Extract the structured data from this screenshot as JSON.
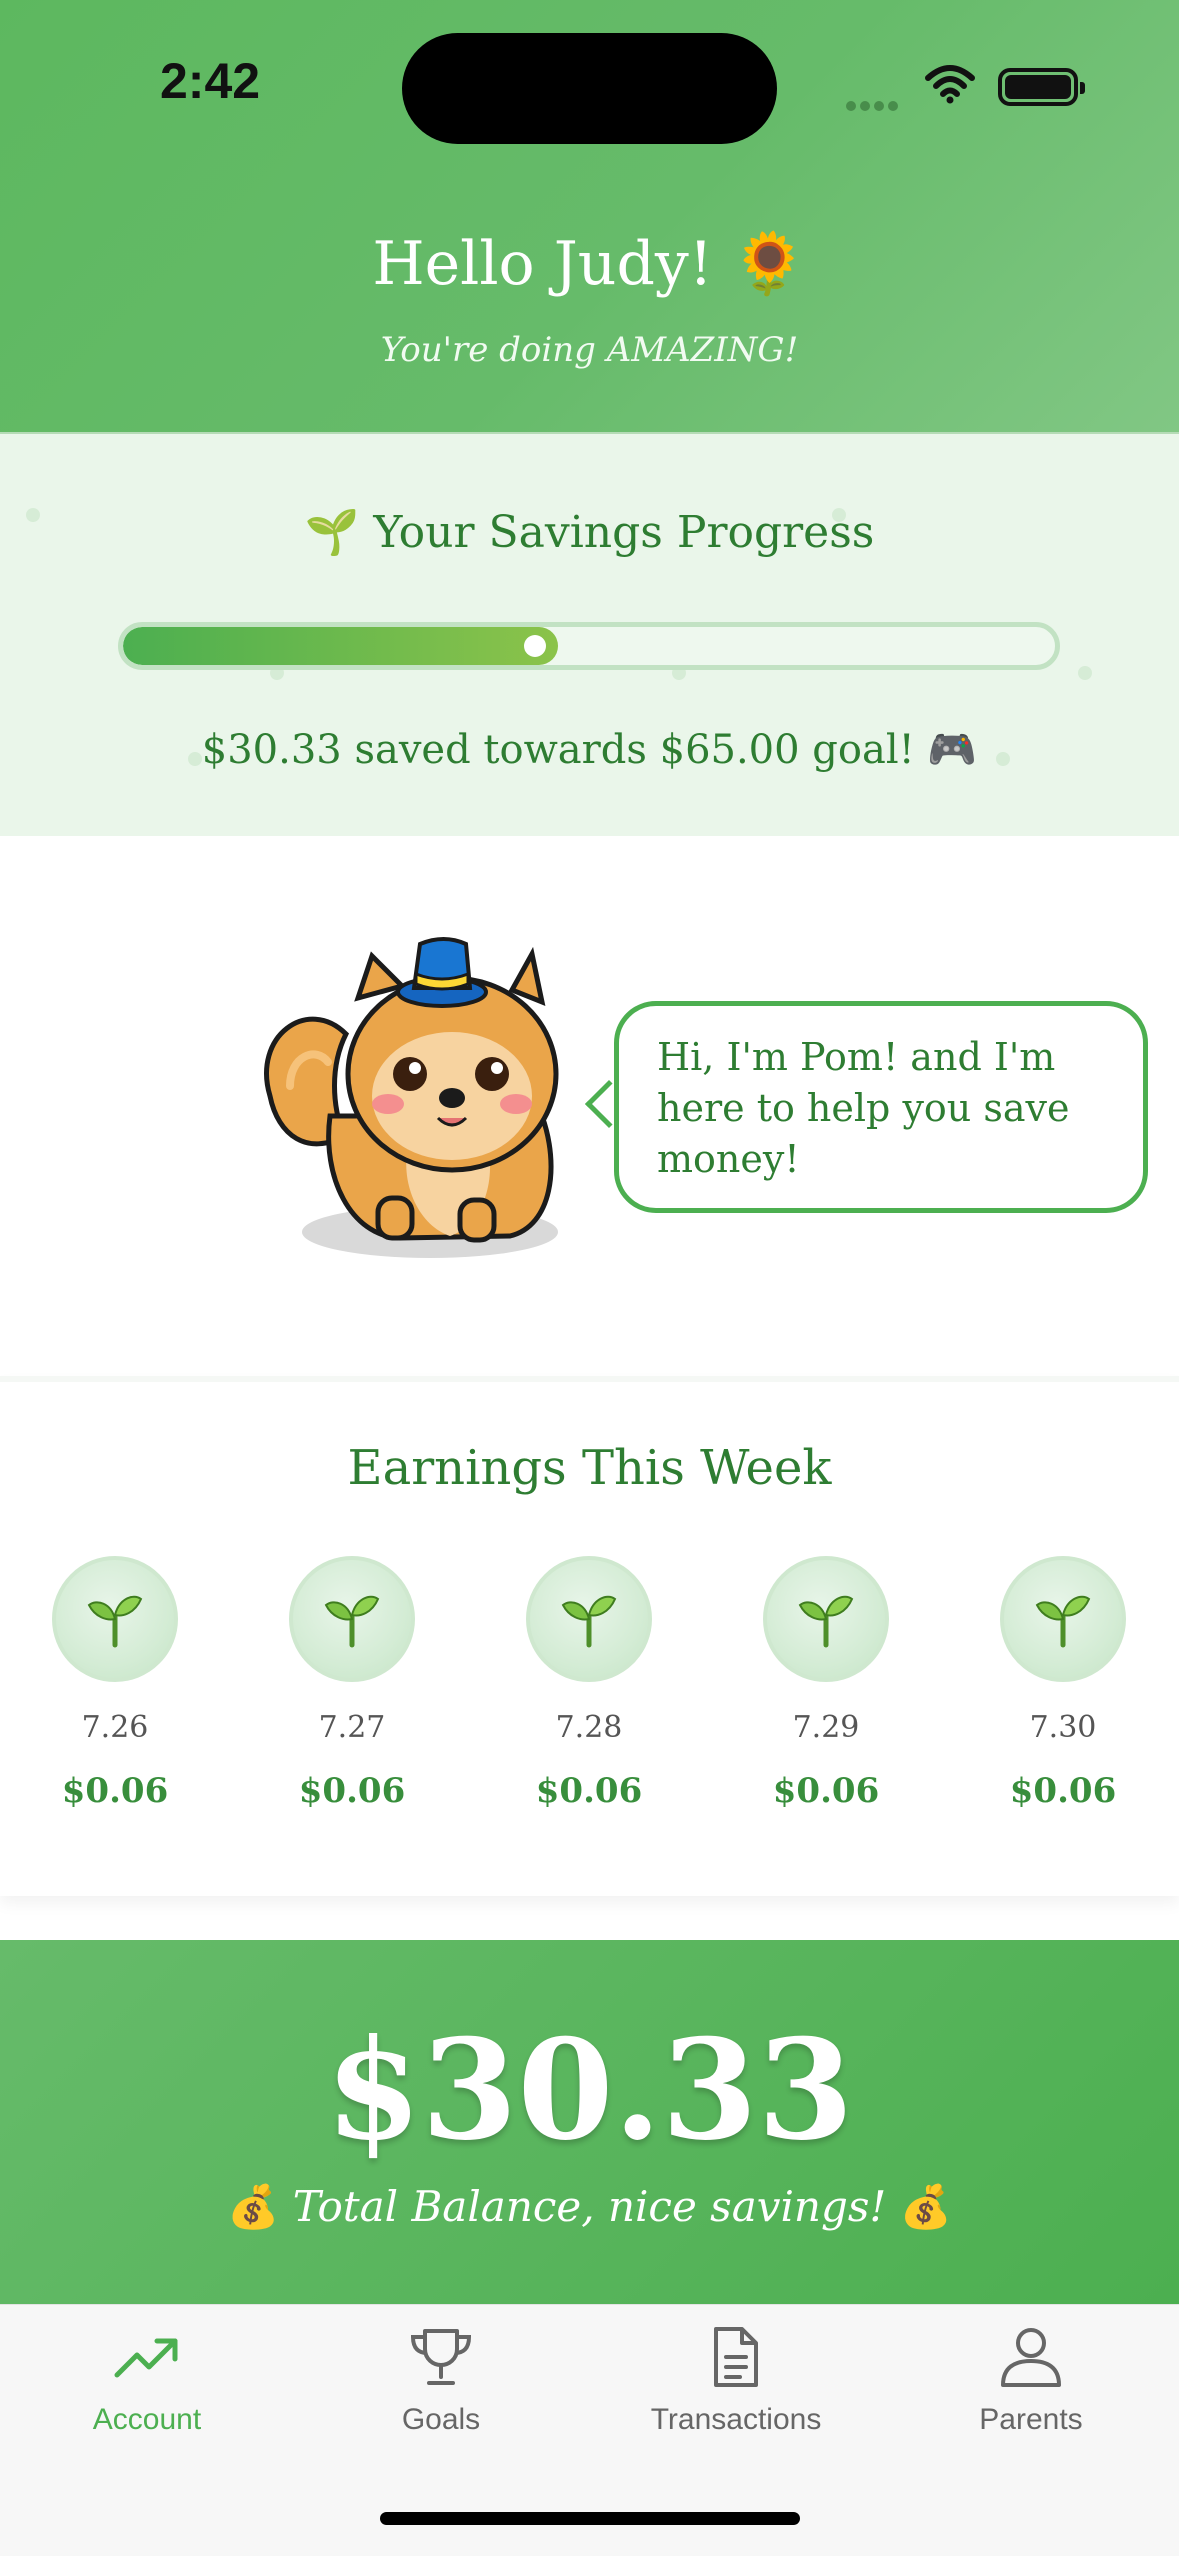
{
  "status_bar": {
    "time": "2:42"
  },
  "header": {
    "greeting": "Hello Judy! 🌻",
    "subtitle": "You're doing AMAZING!"
  },
  "progress": {
    "title": "🌱 Your Savings Progress",
    "saved": 30.33,
    "goal": 65.0,
    "percent": 46.7,
    "caption": "$30.33 saved towards $65.00 goal! 🎮"
  },
  "mascot": {
    "speech": "Hi, I'm Pom! and I'm here to help you save money!"
  },
  "earnings": {
    "title": "Earnings This Week",
    "days": [
      {
        "date": "7.26",
        "amount": "$0.06"
      },
      {
        "date": "7.27",
        "amount": "$0.06"
      },
      {
        "date": "7.28",
        "amount": "$0.06"
      },
      {
        "date": "7.29",
        "amount": "$0.06"
      },
      {
        "date": "7.30",
        "amount": "$0.06"
      }
    ]
  },
  "balance": {
    "amount": "$30.33",
    "caption": "Total Balance, nice savings!",
    "caption_icon": "💰"
  },
  "tabbar": {
    "items": [
      {
        "label": "Account",
        "icon": "trending-up-icon",
        "active": true
      },
      {
        "label": "Goals",
        "icon": "trophy-icon",
        "active": false
      },
      {
        "label": "Transactions",
        "icon": "document-icon",
        "active": false
      },
      {
        "label": "Parents",
        "icon": "person-icon",
        "active": false
      }
    ]
  },
  "colors": {
    "primary": "#4caf50",
    "dark_green": "#2e7d32",
    "light_bg": "#eaf6ea"
  }
}
